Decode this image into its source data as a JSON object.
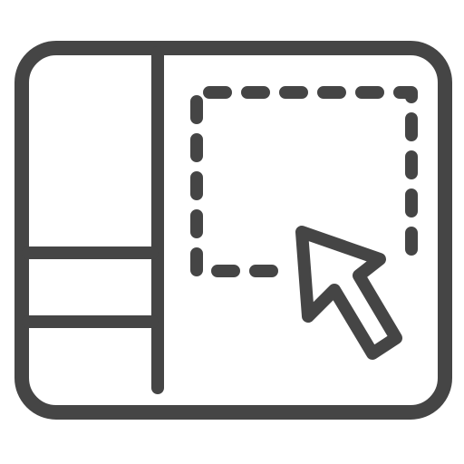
{
  "icon": {
    "name": "layout-drag-select-icon",
    "stroke_color": "#454545",
    "background_color": "#ffffff",
    "parts": {
      "frame": "frame-rounded-rect",
      "sidebar": "sidebar-panel",
      "selection": "dashed-selection-box",
      "cursor": "arrow-cursor"
    }
  }
}
